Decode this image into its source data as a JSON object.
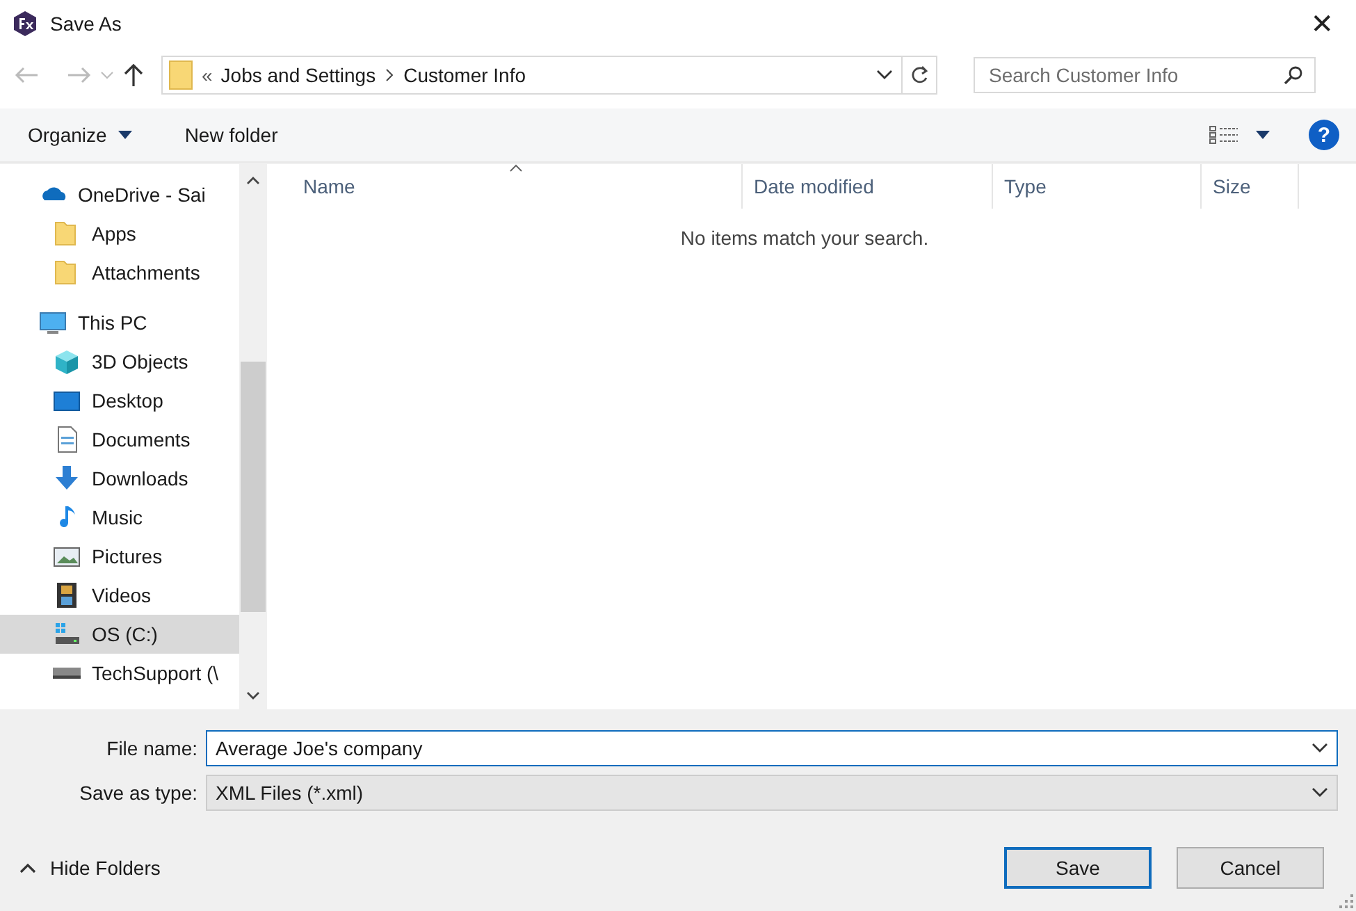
{
  "window": {
    "title": "Save As",
    "close": "✕"
  },
  "nav": {
    "path": [
      {
        "label": "Jobs and Settings"
      },
      {
        "label": "Customer Info"
      }
    ],
    "overflow": "«",
    "search_placeholder": "Search Customer Info"
  },
  "toolbar": {
    "organize": "Organize",
    "new_folder": "New folder",
    "help": "?"
  },
  "sidebar": {
    "items": [
      {
        "label": "OneDrive - Sai",
        "kind": "cloud",
        "selected": false,
        "children": [
          {
            "label": "Apps",
            "kind": "folder",
            "selected": false
          },
          {
            "label": "Attachments",
            "kind": "folder",
            "selected": false
          }
        ]
      },
      {
        "label": "This PC",
        "kind": "pc",
        "selected": false,
        "children": [
          {
            "label": "3D Objects",
            "kind": "cube",
            "selected": false
          },
          {
            "label": "Desktop",
            "kind": "desktop",
            "selected": false
          },
          {
            "label": "Documents",
            "kind": "document",
            "selected": false
          },
          {
            "label": "Downloads",
            "kind": "download",
            "selected": false
          },
          {
            "label": "Music",
            "kind": "music",
            "selected": false
          },
          {
            "label": "Pictures",
            "kind": "pictures",
            "selected": false
          },
          {
            "label": "Videos",
            "kind": "videos",
            "selected": false
          },
          {
            "label": "OS (C:)",
            "kind": "drive",
            "selected": true
          },
          {
            "label": "TechSupport (\\",
            "kind": "netdrive",
            "selected": false
          }
        ]
      }
    ]
  },
  "file_list": {
    "columns": [
      {
        "label": "Name",
        "sorted": true
      },
      {
        "label": "Date modified",
        "sorted": false
      },
      {
        "label": "Type",
        "sorted": false
      },
      {
        "label": "Size",
        "sorted": false
      }
    ],
    "empty_message": "No items match your search."
  },
  "form": {
    "file_name_label": "File name:",
    "file_name": "Average Joe's company",
    "type_label": "Save as type:",
    "type": "XML Files (*.xml)"
  },
  "footer": {
    "hide_folders": "Hide Folders",
    "buttons": [
      {
        "label": "Save",
        "default": true
      },
      {
        "label": "Cancel",
        "default": false
      }
    ]
  }
}
